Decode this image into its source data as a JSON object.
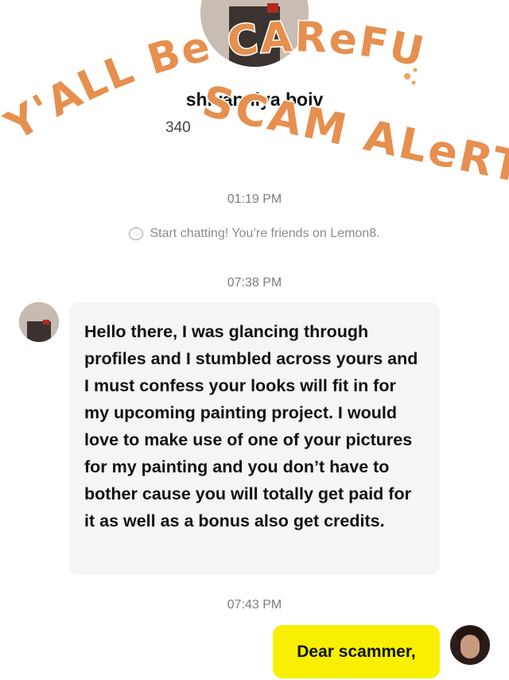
{
  "profile": {
    "name": "shivanniya boiv",
    "stats_prefix": "340"
  },
  "sticker": {
    "line1": "Y'ALL Be CAReFUL",
    "line2": "SCAM ALeRT"
  },
  "colors": {
    "sticker_orange": "#e68f4f",
    "outgoing_bubble": "#f8f000",
    "incoming_bubble": "#f5f5f5"
  },
  "chat": {
    "timestamp_1": "01:19 PM",
    "system_message": "Start chatting! You’re friends on Lemon8.",
    "system_icon": "chat-bubble-icon",
    "timestamp_2": "07:38 PM",
    "incoming_message": "Hello there, I was glancing through profiles and I stumbled across yours and I must confess your looks will fit in for my upcoming painting project. I would love to make use of one of your pictures for my painting and you don’t have to bother cause you will totally get paid for it as well as a bonus also get credits.",
    "timestamp_3": "07:43 PM",
    "outgoing_message": "Dear scammer,"
  }
}
